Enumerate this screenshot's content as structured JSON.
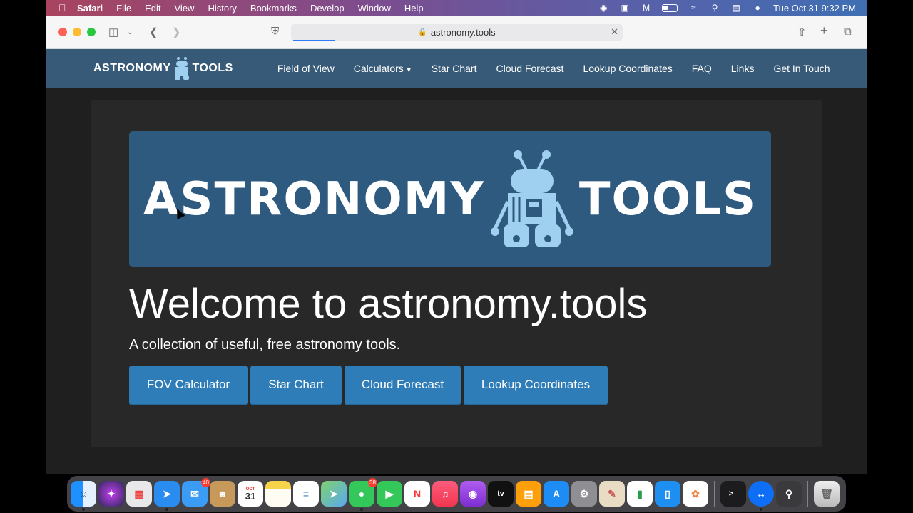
{
  "menubar": {
    "items": [
      "Safari",
      "File",
      "Edit",
      "View",
      "History",
      "Bookmarks",
      "Develop",
      "Window",
      "Help"
    ],
    "datetime": "Tue Oct 31  9:32 PM"
  },
  "browser": {
    "url": "astronomy.tools"
  },
  "site": {
    "brand_left": "ASTRONOMY",
    "brand_right": "TOOLS",
    "nav": [
      "Field of View",
      "Calculators",
      "Star Chart",
      "Cloud Forecast",
      "Lookup Coordinates",
      "FAQ",
      "Links",
      "Get In Touch"
    ],
    "banner_left": "ASTRONOMY",
    "banner_right": "TOOLS",
    "heading": "Welcome to astronomy.tools",
    "tagline": "A collection of useful, free astronomy tools.",
    "buttons": [
      "FOV Calculator",
      "Star Chart",
      "Cloud Forecast",
      "Lookup Coordinates"
    ]
  },
  "dock": {
    "calendar_month": "OCT",
    "calendar_day": "31",
    "mail_badge": "40",
    "messages_badge": "38"
  },
  "colors": {
    "navbar": "#365a78",
    "banner": "#2f5a80",
    "button": "#2e7cb8",
    "robot": "#9fd0ef"
  }
}
